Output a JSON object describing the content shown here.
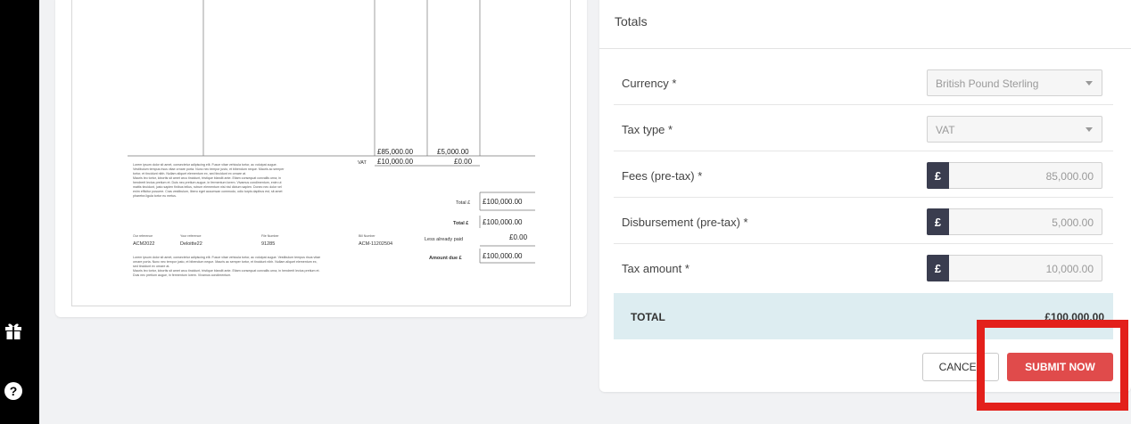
{
  "sidebar": {
    "icons": [
      "gift-icon",
      "help-icon"
    ],
    "help_glyph": "?"
  },
  "invoice": {
    "fees_col": "£85,000.00",
    "disb_col": "£5,000.00",
    "vat_label": "VAT",
    "vat_value": "£10,000.00",
    "vat_disb": "£0.00",
    "lorem_1": [
      "Lorem ipsum dolor sit amet, consectetur adipiscing elit. Fusce vitae vehicula tortor, ac volutpat augue.",
      "Vestibulum tempus risus vitae ornare porta. Nunc nec tempor justo, et bibendum neque. Mauris ac semper",
      "tortor, et tincidunt nibh. Nullam aliquet elementum ex, sed tincidunt ex ornare at.",
      "Mauris leo tortor, lobortis sit amet arcu tincidunt, tristique blandit ante. Etiam consequat convallis urna, in",
      "hendrerit lectus pretium et. Duis nec pretium augue, in fermentum lorem. Vivamus condimentum, enim ut",
      "mattis tincidunt, justo sapien finibus tellus, rutrum elementum nisl nisl dictum sapien. Donec nec dolor vel",
      "enim efficitur posuere. Cras vestibulum, libero eget accumsan commodo, odio turpis dapibus est, sit amet",
      "pharetra ligula tortor eu metus."
    ],
    "total_label_1": "Total £",
    "total_value_1": "£100,000.00",
    "total_label_2": "Total £",
    "total_value_2": "£100,000.00",
    "less_paid_label": "Less already paid",
    "less_paid_value": "£0.00",
    "amount_due_label": "Amount due £",
    "amount_due_value": "£100,000.00",
    "refs": {
      "our_ref_label": "Our reference",
      "our_ref_value": "ACM2022",
      "your_ref_label": "Your reference",
      "your_ref_value": "Deloitte22",
      "file_label": "File Number",
      "file_value": "91285",
      "bill_label": "Bill Number",
      "bill_value": "ACM-11202504"
    },
    "lorem_2": [
      "Lorem ipsum dolor sit amet, consectetur adipiscing elit. Fusce vitae vehicula tortor, ac volutpat augue. Vestibulum tempus risus vitae",
      "ornare porta. Nunc nec tempor justo, et bibendum neque. Mauris ac semper tortor, et tincidunt nibh. Nullam aliquet elementum ex,",
      "sed tincidunt ex ornare at.",
      "Mauris leo tortor, lobortis sit amet arcu tincidunt, tristique blandit ante. Etiam consequat convallis urna, in hendrerit lectus pretium et.",
      "Duis nec pretium augue, in fermentum lorem. Vivamus condimentum."
    ]
  },
  "totals": {
    "title": "Totals",
    "currency_label": "Currency *",
    "currency_value": "British Pound Sterling",
    "tax_type_label": "Tax type *",
    "tax_type_value": "VAT",
    "fees_label": "Fees (pre-tax) *",
    "fees_value": "85,000.00",
    "disb_label": "Disbursement (pre-tax) *",
    "disb_value": "5,000.00",
    "tax_amount_label": "Tax amount *",
    "tax_amount_value": "10,000.00",
    "currency_symbol": "£",
    "total_label": "TOTAL",
    "total_value": "£100,000.00",
    "cancel_label": "CANCEL",
    "submit_label": "SUBMIT NOW"
  },
  "colors": {
    "rail": "#000000",
    "submit": "#e04b4b",
    "currency_badge": "#3a3d4f",
    "total_row": "#ddedf1",
    "highlight": "#e3201b"
  }
}
